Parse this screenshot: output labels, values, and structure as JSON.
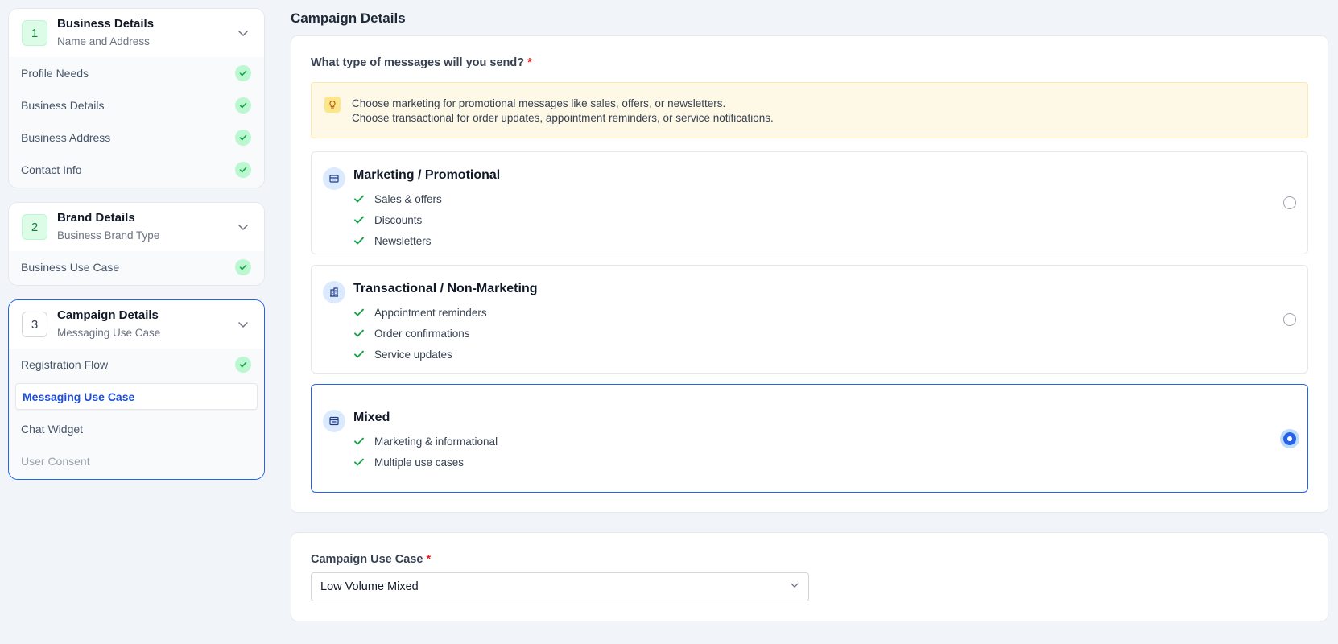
{
  "sidebar": {
    "steps": [
      {
        "number": "1",
        "title": "Business Details",
        "subtitle": "Name and Address",
        "items": [
          {
            "label": "Profile Needs"
          },
          {
            "label": "Business Details"
          },
          {
            "label": "Business Address"
          },
          {
            "label": "Contact Info"
          }
        ]
      },
      {
        "number": "2",
        "title": "Brand Details",
        "subtitle": "Business Brand Type",
        "items": [
          {
            "label": "Business Use Case"
          }
        ]
      },
      {
        "number": "3",
        "title": "Campaign Details",
        "subtitle": "Messaging Use Case",
        "items": [
          {
            "label": "Registration Flow"
          },
          {
            "label": "Messaging Use Case"
          },
          {
            "label": "Chat Widget"
          },
          {
            "label": "User Consent"
          }
        ]
      }
    ]
  },
  "main": {
    "section_title": "Campaign Details",
    "question": "What type of messages will you send?",
    "required_mark": "*",
    "info": {
      "line1": "Choose marketing for promotional messages like sales, offers, or newsletters.",
      "line2": "Choose transactional for order updates, appointment reminders, or service notifications."
    },
    "options": [
      {
        "title": "Marketing / Promotional",
        "features": [
          "Sales & offers",
          "Discounts",
          "Newsletters"
        ],
        "selected": false
      },
      {
        "title": "Transactional / Non-Marketing",
        "features": [
          "Appointment reminders",
          "Order confirmations",
          "Service updates"
        ],
        "selected": false
      },
      {
        "title": "Mixed",
        "features": [
          "Marketing & informational",
          "Multiple use cases"
        ],
        "selected": true
      }
    ],
    "use_case": {
      "label": "Campaign Use Case",
      "required_mark": "*",
      "value": "Low Volume Mixed"
    }
  },
  "colors": {
    "accent": "#2563eb",
    "success": "#16a34a",
    "warning_bg": "#fef9e7",
    "required": "#dc2626"
  },
  "icons": {
    "step_chevron": "chevron-down-icon",
    "completed": "check-circle-icon",
    "info": "lightbulb-icon",
    "option_marketing": "storefront-icon",
    "option_transactional": "building-icon",
    "option_mixed": "store-icon",
    "feature": "check-icon",
    "select": "chevron-down-icon"
  }
}
